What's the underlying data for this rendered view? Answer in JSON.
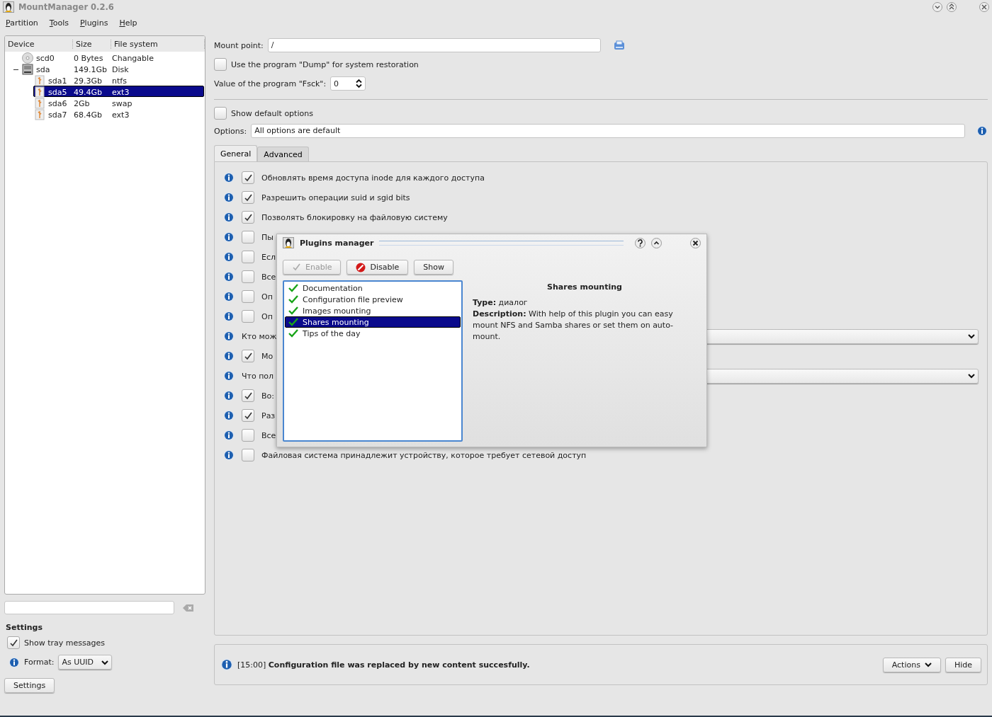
{
  "window": {
    "title": "MountManager 0.2.6"
  },
  "menu": [
    {
      "label": "Partition"
    },
    {
      "label": "Tools"
    },
    {
      "label": "Plugins"
    },
    {
      "label": "Help"
    }
  ],
  "device_tree": {
    "columns": [
      "Device",
      "Size",
      "File system"
    ],
    "rows": [
      {
        "kind": "cdrom",
        "device": "scd0",
        "size": "0 Bytes",
        "fs": "Changable",
        "selected": false
      },
      {
        "kind": "disk",
        "device": "sda",
        "size": "149.1Gb",
        "fs": "Disk",
        "selected": false,
        "expanded": true,
        "children": [
          {
            "kind": "partition",
            "device": "sda1",
            "size": "29.3Gb",
            "fs": "ntfs",
            "selected": false
          },
          {
            "kind": "partition",
            "device": "sda5",
            "size": "49.4Gb",
            "fs": "ext3",
            "selected": true
          },
          {
            "kind": "partition",
            "device": "sda6",
            "size": "2Gb",
            "fs": "swap",
            "selected": false
          },
          {
            "kind": "partition",
            "device": "sda7",
            "size": "68.4Gb",
            "fs": "ext3",
            "selected": false
          }
        ]
      }
    ]
  },
  "settings": {
    "title": "Settings",
    "tray": {
      "label": "Show tray messages",
      "checked": true
    },
    "format": {
      "label": "Format:",
      "value": "As UUID"
    },
    "button": "Settings"
  },
  "mount_point": {
    "label": "Mount point:",
    "value": "/"
  },
  "dump": {
    "label": "Use the program \"Dump\" for system restoration",
    "checked": false
  },
  "fsck": {
    "label": "Value of the program \"Fsck\":",
    "value": "0"
  },
  "show_default": {
    "label": "Show default options",
    "checked": false
  },
  "options": {
    "label": "Options:",
    "value": "All options are default"
  },
  "tabs": [
    {
      "label": "General",
      "selected": true
    },
    {
      "label": "Advanced",
      "selected": false
    }
  ],
  "option_rows": [
    {
      "kind": "check",
      "label": "Обновлять время доступа inode для каждого доступа",
      "checked": true
    },
    {
      "kind": "check",
      "label": "Разрешить операции suid и sgid bits",
      "checked": true
    },
    {
      "kind": "check",
      "label": "Позволять блокировку на файловую систему",
      "checked": true
    },
    {
      "kind": "check",
      "label": "Пы",
      "checked": false
    },
    {
      "kind": "check",
      "label": "Есл",
      "checked": false
    },
    {
      "kind": "check",
      "label": "Все",
      "checked": false
    },
    {
      "kind": "check",
      "label": "Оп",
      "checked": false
    },
    {
      "kind": "check",
      "label": "Оп",
      "checked": false
    },
    {
      "kind": "combo",
      "label": "Кто мож"
    },
    {
      "kind": "check",
      "label": "Мо",
      "checked": true
    },
    {
      "kind": "combo",
      "label": "Что пол"
    },
    {
      "kind": "check",
      "label": "Во:",
      "checked": true
    },
    {
      "kind": "check",
      "label": "Раз",
      "checked": true
    },
    {
      "kind": "check",
      "label": "Все",
      "checked": false
    },
    {
      "kind": "check",
      "label": "Файловая система принадлежит устройству, которое требует сетевой доступ",
      "checked": false
    }
  ],
  "plugins_dialog": {
    "title": "Plugins manager",
    "buttons": [
      {
        "kind": "enable",
        "label": "Enable",
        "disabled": true
      },
      {
        "kind": "disable",
        "label": "Disable",
        "disabled": false
      },
      {
        "kind": "plain",
        "label": "Show",
        "disabled": false
      }
    ],
    "plugins": [
      {
        "name": "Documentation",
        "enabled": true,
        "selected": false
      },
      {
        "name": "Configuration file preview",
        "enabled": true,
        "selected": false
      },
      {
        "name": "Images mounting",
        "enabled": true,
        "selected": false
      },
      {
        "name": "Shares mounting",
        "enabled": true,
        "selected": true
      },
      {
        "name": "Tips of the day",
        "enabled": true,
        "selected": false
      }
    ],
    "details": {
      "title": "Shares mounting",
      "lines": [
        "**Type:** диалог",
        "**Description:** With help of this plugin you can easy mount NFS and Samba shares or set them on auto-mount."
      ]
    }
  },
  "status": {
    "message": "[15:00] **Configuration file was replaced by new content succesfully.**",
    "buttons": [
      {
        "kind": "menu",
        "label": "Actions"
      },
      {
        "kind": "plain",
        "label": "Hide"
      }
    ]
  }
}
